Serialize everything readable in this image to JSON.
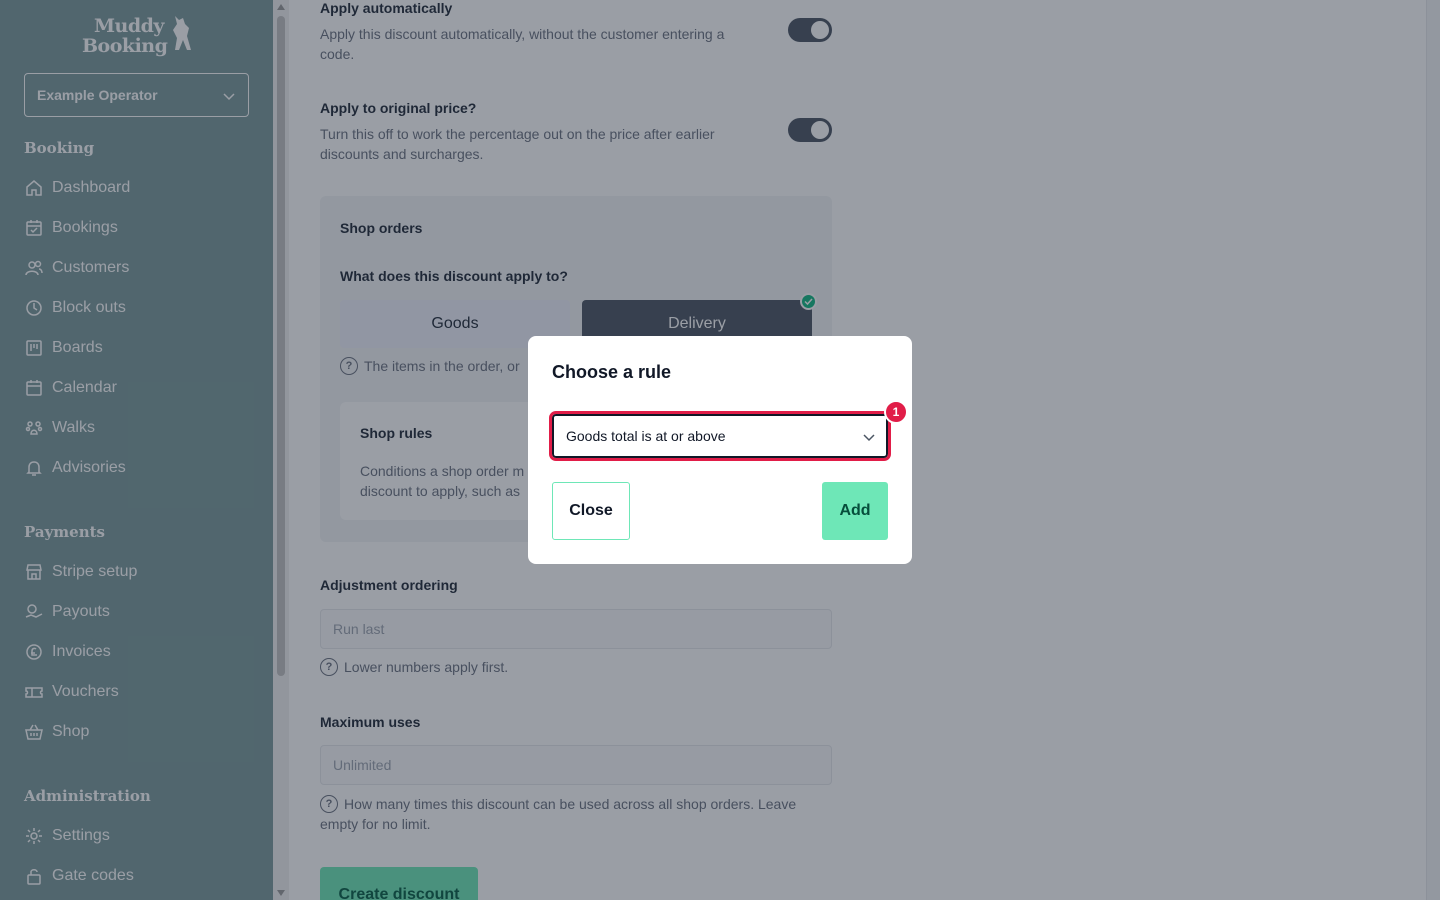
{
  "brand": {
    "line1": "Muddy",
    "line2": "Booking"
  },
  "operator": {
    "selected": "Example Operator"
  },
  "sidebar": {
    "sections": [
      {
        "title": "Booking",
        "items": [
          {
            "label": "Dashboard",
            "icon": "home-icon"
          },
          {
            "label": "Bookings",
            "icon": "calendar-check-icon"
          },
          {
            "label": "Customers",
            "icon": "users-icon"
          },
          {
            "label": "Block outs",
            "icon": "clock-icon"
          },
          {
            "label": "Boards",
            "icon": "board-icon"
          },
          {
            "label": "Calendar",
            "icon": "calendar-icon"
          },
          {
            "label": "Walks",
            "icon": "paw-icon"
          },
          {
            "label": "Advisories",
            "icon": "bell-icon"
          }
        ]
      },
      {
        "title": "Payments",
        "items": [
          {
            "label": "Stripe setup",
            "icon": "store-icon"
          },
          {
            "label": "Payouts",
            "icon": "payout-icon"
          },
          {
            "label": "Invoices",
            "icon": "pound-icon"
          },
          {
            "label": "Vouchers",
            "icon": "ticket-icon"
          },
          {
            "label": "Shop",
            "icon": "basket-icon"
          }
        ]
      },
      {
        "title": "Administration",
        "items": [
          {
            "label": "Settings",
            "icon": "gear-icon"
          },
          {
            "label": "Gate codes",
            "icon": "lock-icon"
          }
        ]
      }
    ]
  },
  "form": {
    "apply_auto": {
      "title": "Apply automatically",
      "desc1": "Apply this discount automatically, without the customer entering a",
      "desc2": "code."
    },
    "apply_original": {
      "title": "Apply to original price?",
      "desc1": "Turn this off to work the percentage out on the price after earlier",
      "desc2": "discounts and surcharges."
    },
    "shop": {
      "title": "Shop orders",
      "question": "What does this discount apply to?",
      "option_goods": "Goods",
      "option_delivery": "Delivery",
      "help": "The items in the order, or",
      "rules_title": "Shop rules",
      "rules_desc1": "Conditions a shop order m",
      "rules_desc2": "discount to apply, such as"
    },
    "ordering": {
      "title": "Adjustment ordering",
      "placeholder": "Run last",
      "help": "Lower numbers apply first."
    },
    "max_uses": {
      "title": "Maximum uses",
      "placeholder": "Unlimited",
      "help1": "How many times this discount can be used across all shop orders. Leave",
      "help2": "empty for no limit."
    },
    "create_label": "Create discount"
  },
  "modal": {
    "title": "Choose a rule",
    "selected_rule": "Goods total is at or above",
    "badge": "1",
    "close_label": "Close",
    "add_label": "Add"
  },
  "colors": {
    "sidebar": "#7a9a9c",
    "accent": "#6ee7b7",
    "alert": "#e11d48"
  }
}
